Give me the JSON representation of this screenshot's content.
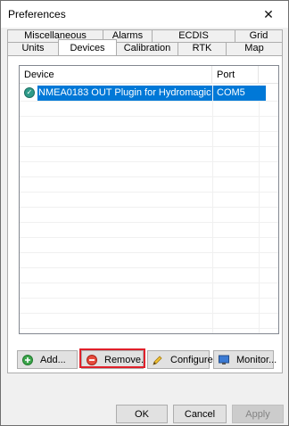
{
  "window": {
    "title": "Preferences",
    "close_glyph": "✕"
  },
  "tabs_row1": [
    {
      "label": "Miscellaneous"
    },
    {
      "label": "Alarms"
    },
    {
      "label": "ECDIS"
    },
    {
      "label": "Grid"
    }
  ],
  "tabs_row2": [
    {
      "label": "Units"
    },
    {
      "label": "Devices",
      "active": true
    },
    {
      "label": "Calibration"
    },
    {
      "label": "RTK"
    },
    {
      "label": "Map"
    }
  ],
  "devices": {
    "columns": {
      "device": "Device",
      "port": "Port"
    },
    "rows": [
      {
        "device": "NMEA0183 OUT Plugin for Hydromagic",
        "port": "COM5",
        "icon": "device-plugin-icon",
        "selected": true
      }
    ]
  },
  "actions": {
    "add": {
      "label": "Add...",
      "icon": "add-icon"
    },
    "remove": {
      "label": "Remove...",
      "icon": "remove-icon"
    },
    "configure": {
      "label": "Configure...",
      "icon": "pencil-icon"
    },
    "monitor": {
      "label": "Monitor...",
      "icon": "monitor-icon"
    }
  },
  "dialog_buttons": {
    "ok": "OK",
    "cancel": "Cancel",
    "apply": "Apply"
  },
  "colors": {
    "selection": "#0078d7",
    "highlight_box": "#e0202a"
  }
}
